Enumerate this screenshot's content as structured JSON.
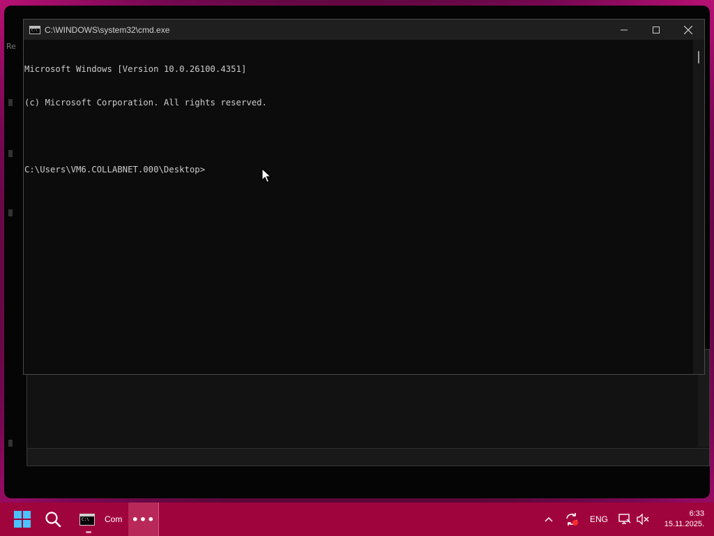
{
  "desktop": {
    "edge_text": "Re"
  },
  "cmd_window": {
    "title": "C:\\WINDOWS\\system32\\cmd.exe",
    "icon_label": "C:\\",
    "controls": {
      "minimize_icon": "minimize-icon",
      "maximize_icon": "maximize-icon",
      "close_icon": "close-icon"
    },
    "terminal_lines": [
      "Microsoft Windows [Version 10.0.26100.4351]",
      "(c) Microsoft Corporation. All rights reserved.",
      "",
      "C:\\Users\\VM6.COLLABNET.000\\Desktop>"
    ]
  },
  "taskbar": {
    "start_icon": "windows-start-icon",
    "search_icon": "search-icon",
    "cmd_task": {
      "icon_label": "C:\\",
      "label": "Com"
    },
    "more_label": "•••",
    "tray": {
      "language": "ENG",
      "time": "6:33",
      "date": "15.11.2025."
    }
  },
  "colors": {
    "taskbar": "#a0043c",
    "wallpaper_glow": "#c0187a",
    "terminal_bg": "#0c0c0c",
    "terminal_text": "#cccccc"
  }
}
